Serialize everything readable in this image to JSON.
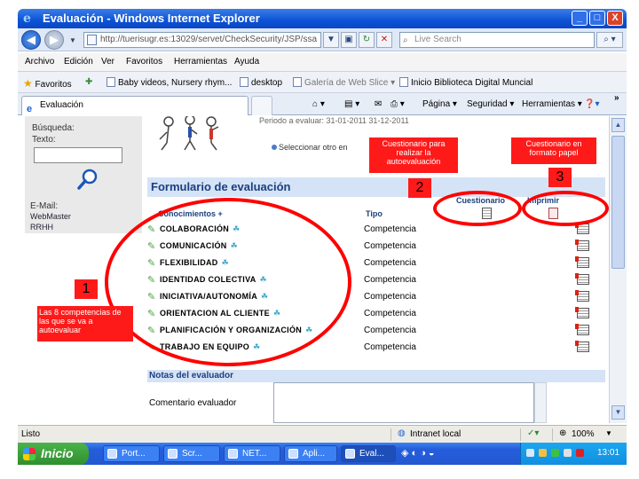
{
  "window": {
    "title": "Evaluación - Windows Internet Explorer",
    "minimize": "_",
    "maximize": "□",
    "close": "X"
  },
  "addressbar": {
    "url": "http://tuerisugr.es:13029/servet/CheckSecurity/JSP/ssa",
    "search_placeholder": "Live Search"
  },
  "menu": {
    "items": [
      "Archivo",
      "Edición",
      "Ver",
      "Favoritos",
      "Herramientas",
      "Ayuda"
    ]
  },
  "favorites": {
    "label": "Favoritos",
    "items": [
      "Baby videos, Nursery rhym...",
      "desktop",
      "Galería de Web Slice",
      "Inicio Biblioteca Digital Muncial"
    ]
  },
  "tabs": {
    "active": "Evaluación",
    "tools": [
      "Página",
      "Seguridad",
      "Herramientas"
    ]
  },
  "sidebar": {
    "search_label": "Búsqueda:",
    "text_label": "Texto:",
    "email_label": "E-Mail:",
    "links": [
      "WebMaster",
      "RRHH"
    ]
  },
  "content": {
    "periodo": "Periodo a evaluar: 31-01-2011 31-12-2011",
    "select_other": "Seleccionar otro en",
    "form_title": "Formulario de evaluación",
    "col_conocimientos": "Conocimientos",
    "col_tipo": "Tipo",
    "col_cuestionario": "Cuestionario",
    "col_imprimir": "Imprimir",
    "competencias": [
      {
        "name": "COLABORACIÓN",
        "tipo": "Competencia"
      },
      {
        "name": "COMUNICACIÓN",
        "tipo": "Competencia"
      },
      {
        "name": "FLEXIBILIDAD",
        "tipo": "Competencia"
      },
      {
        "name": "IDENTIDAD COLECTIVA",
        "tipo": "Competencia"
      },
      {
        "name": "INICIATIVA/AUTONOMÍA",
        "tipo": "Competencia"
      },
      {
        "name": "ORIENTACION AL CLIENTE",
        "tipo": "Competencia"
      },
      {
        "name": "PLANIFICACIÓN Y ORGANIZACIÓN",
        "tipo": "Competencia"
      },
      {
        "name": "TRABAJO EN EQUIPO",
        "tipo": "Competencia"
      }
    ],
    "notas_title": "Notas del evaluador",
    "comentario_label": "Comentario evaluador"
  },
  "annotations": {
    "callout_1": "Las 8 competencias de las que se va a autoevaluar",
    "callout_2": "Cuestionario para realizar la autoevaluación",
    "callout_3": "Cuestionario en formato papel",
    "num_1": "1",
    "num_2": "2",
    "num_3": "3"
  },
  "statusbar": {
    "status": "Listo",
    "zone": "Intranet local",
    "zoom": "100%"
  },
  "taskbar": {
    "start": "Inicio",
    "tasks": [
      "Port...",
      "Scr...",
      "NET...",
      "Apli...",
      "Eval..."
    ],
    "clock": "13:01"
  },
  "colors": {
    "annotation": "#ff1a1a",
    "header_bg": "#d5e3f6",
    "header_text": "#1c3f7e",
    "title_bar": "#0c52d6"
  }
}
